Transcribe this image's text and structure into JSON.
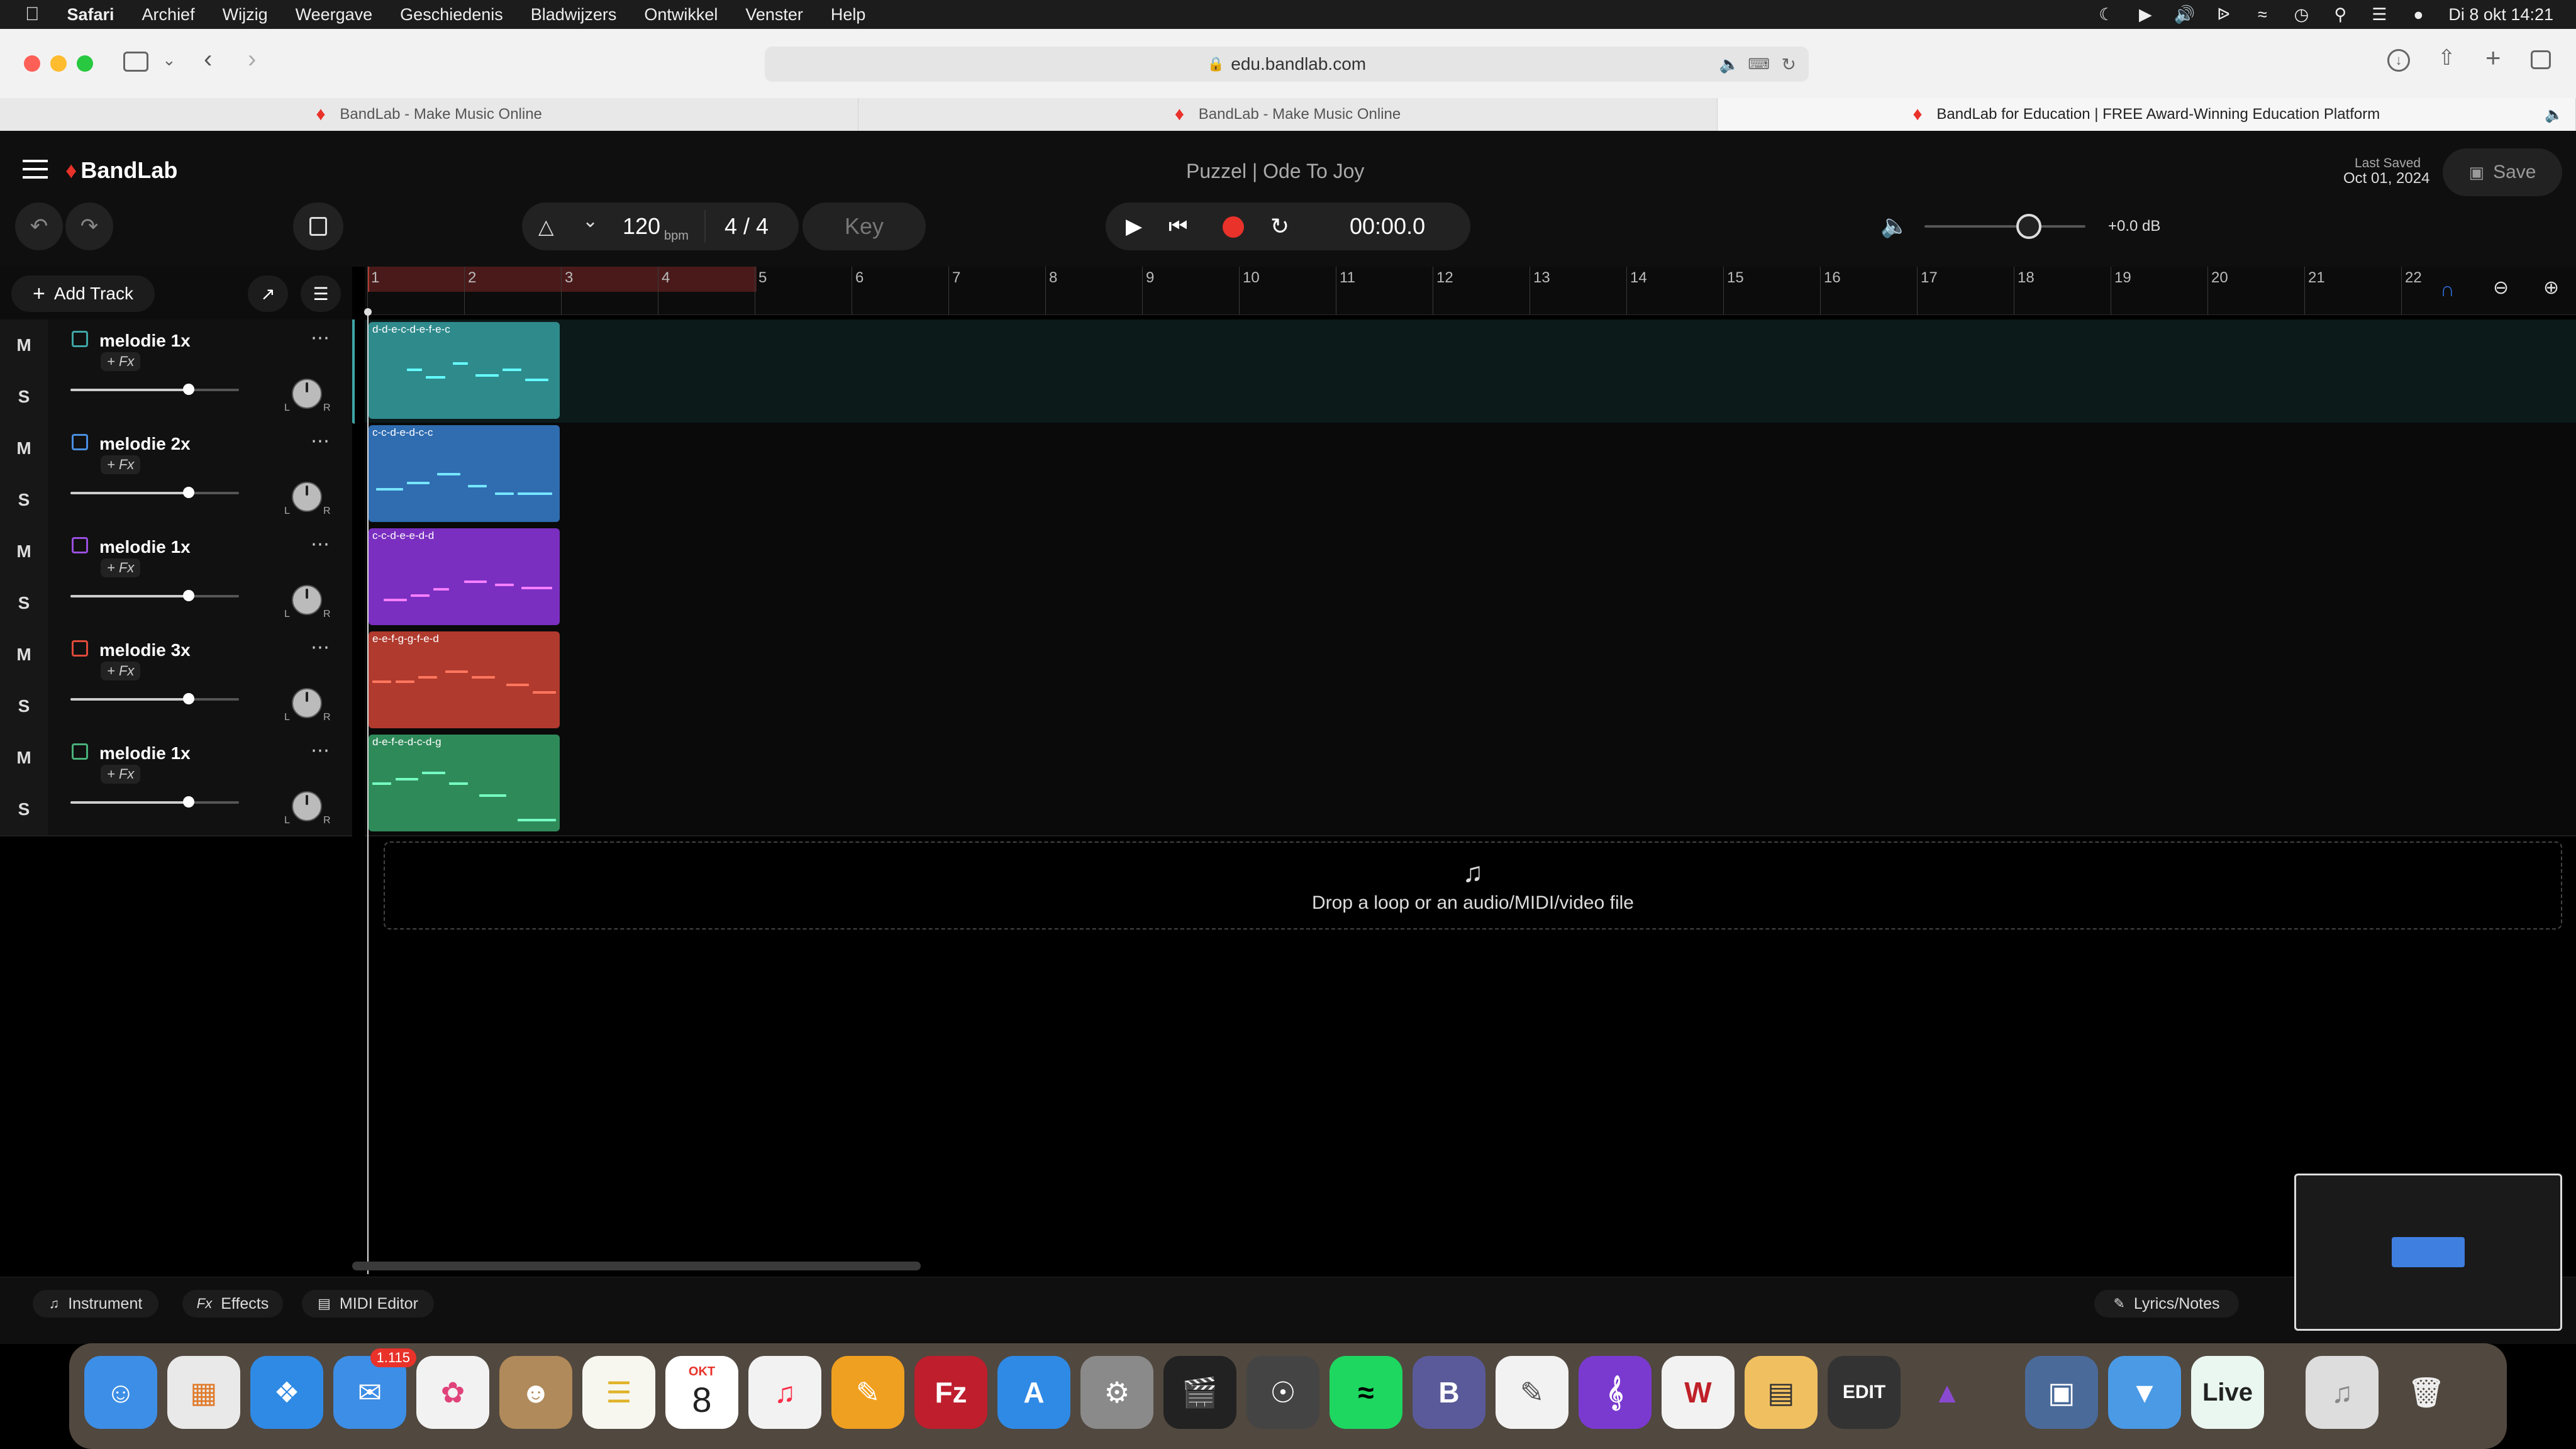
{
  "menubar": {
    "app": "Safari",
    "items": [
      "Archief",
      "Wijzig",
      "Weergave",
      "Geschiedenis",
      "Bladwijzers",
      "Ontwikkel",
      "Venster",
      "Help"
    ],
    "clock": "Di 8 okt  14:21"
  },
  "browser": {
    "url": "edu.bandlab.com",
    "tabs": [
      {
        "title": "BandLab - Make Music Online"
      },
      {
        "title": "BandLab - Make Music Online"
      },
      {
        "title": "BandLab for Education | FREE Award-Winning Education Platform"
      }
    ]
  },
  "bandlab": {
    "logo": "BandLab",
    "project_title": "Puzzel | Ode To Joy",
    "last_saved_label": "Last Saved",
    "last_saved_date": "Oct 01, 2024",
    "save_label": "Save",
    "bpm_value": "120",
    "bpm_unit": "bpm",
    "time_sig": "4 / 4",
    "key_label": "Key",
    "time_display": "00:00.0",
    "master_db": "+0.0 dB",
    "master_volume": 0.65,
    "add_track_label": "Add Track",
    "drop_zone_text": "Drop a loop or an audio/MIDI/video file",
    "bar_numbers": [
      "1",
      "2",
      "3",
      "4",
      "5",
      "6",
      "7",
      "8",
      "9",
      "10",
      "11",
      "12",
      "13",
      "14",
      "15",
      "16",
      "17",
      "18",
      "19",
      "20",
      "21",
      "22"
    ]
  },
  "tracks": [
    {
      "name": "melodie 1x",
      "fx": "+ Fx",
      "mute": "M",
      "solo": "S",
      "volume": 0.7,
      "color": "#3fa6a6",
      "clip_label": "d-d-e-c-d-e-f-e-c",
      "clip_color": "#2f8a8c"
    },
    {
      "name": "melodie 2x",
      "fx": "+ Fx",
      "mute": "M",
      "solo": "S",
      "volume": 0.7,
      "color": "#4a8fe0",
      "clip_label": "c-c-d-e-d-c-c",
      "clip_color": "#2f6cb0"
    },
    {
      "name": "melodie 1x",
      "fx": "+ Fx",
      "mute": "M",
      "solo": "S",
      "volume": 0.7,
      "color": "#9a4fe0",
      "clip_label": "c-c-d-e-e-d-d",
      "clip_color": "#7a2fc0"
    },
    {
      "name": "melodie 3x",
      "fx": "+ Fx",
      "mute": "M",
      "solo": "S",
      "volume": 0.7,
      "color": "#e04a3a",
      "clip_label": "e-e-f-g-g-f-e-d",
      "clip_color": "#b03a2e"
    },
    {
      "name": "melodie 1x",
      "fx": "+ Fx",
      "mute": "M",
      "solo": "S",
      "volume": 0.7,
      "color": "#4ab07a",
      "clip_label": "d-e-f-e-d-c-d-g",
      "clip_color": "#2f8a5a"
    }
  ],
  "bottom_tabs": {
    "instrument": "Instrument",
    "effects": "Effects",
    "midi_editor": "MIDI Editor",
    "lyrics": "Lyrics/Notes",
    "fx_prefix": "Fx"
  },
  "dock": {
    "mail_badge": "1.115",
    "calendar_month": "OKT",
    "calendar_day": "8",
    "xedit_label": "EDIT",
    "live_label": "Live"
  }
}
